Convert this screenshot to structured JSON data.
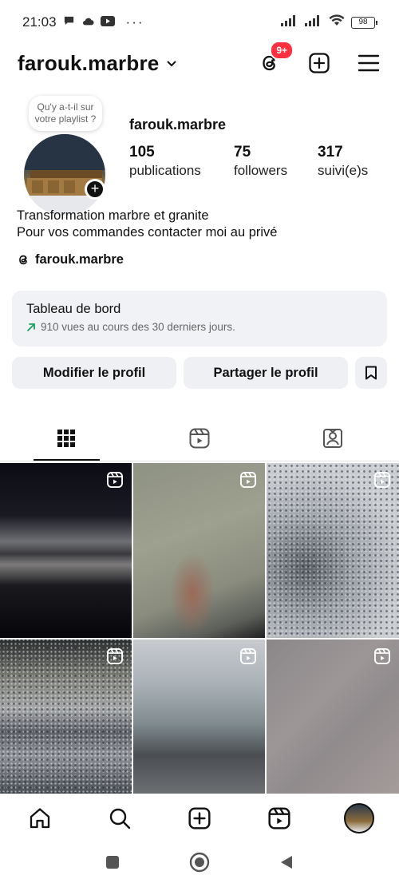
{
  "status_bar": {
    "time": "21:03",
    "battery": "98",
    "notification_icons": [
      "chat-icon",
      "cloud-icon",
      "youtube-icon",
      "more-dots-icon"
    ]
  },
  "header": {
    "username": "farouk.marbre",
    "notification_badge": "9+"
  },
  "profile": {
    "note_bubble": "Qu'y a-t-il sur votre playlist ?",
    "display_name": "farouk.marbre",
    "stats": [
      {
        "value": "105",
        "label": "publications"
      },
      {
        "value": "75",
        "label": "followers"
      },
      {
        "value": "317",
        "label": "suivi(e)s"
      }
    ],
    "bio_line_1": "Transformation marbre et granite",
    "bio_line_2": "Pour vos commandes contacter moi au privé",
    "threads_handle": "farouk.marbre"
  },
  "dashboard": {
    "title": "Tableau de bord",
    "subtitle": "910 vues au cours des 30 derniers jours."
  },
  "actions": {
    "edit_label": "Modifier le profil",
    "share_label": "Partager le profil"
  },
  "tabs": [
    {
      "icon": "grid-icon",
      "active": true
    },
    {
      "icon": "reels-icon",
      "active": false
    },
    {
      "icon": "tagged-icon",
      "active": false
    }
  ],
  "posts": [
    {
      "type": "reel"
    },
    {
      "type": "reel"
    },
    {
      "type": "reel"
    },
    {
      "type": "reel"
    },
    {
      "type": "reel"
    },
    {
      "type": "reel"
    }
  ],
  "bottom_nav": [
    "home-icon",
    "search-icon",
    "create-icon",
    "reels-icon",
    "profile-avatar"
  ],
  "colors": {
    "badge": "#ff3040",
    "button_bg": "#eef0f3",
    "dashboard_bg": "#f0f2f5",
    "trend_green": "#1aa260"
  }
}
